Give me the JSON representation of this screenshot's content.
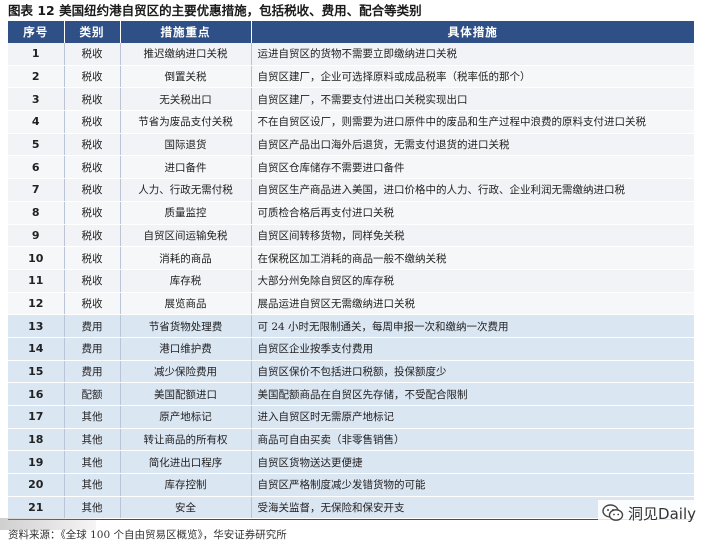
{
  "title": "图表 12  美国纽约港自贸区的主要优惠措施，包括税收、费用、配合等类别",
  "headers": [
    "序号",
    "类别",
    "措施重点",
    "具体措施"
  ],
  "rows": [
    {
      "no": "1",
      "category": "税收",
      "measure": "推迟缴纳进口关税",
      "detail": "运进自贸区的货物不需要立即缴纳进口关税"
    },
    {
      "no": "2",
      "category": "税收",
      "measure": "倒置关税",
      "detail": "自贸区建厂，企业可选择原料或成品税率（税率低的那个）"
    },
    {
      "no": "3",
      "category": "税收",
      "measure": "无关税出口",
      "detail": "自贸区建厂，不需要支付进出口关税实现出口"
    },
    {
      "no": "4",
      "category": "税收",
      "measure": "节省为废品支付关税",
      "detail": "不在自贸区设厂，则需要为进口原件中的废品和生产过程中浪费的原料支付进口关税"
    },
    {
      "no": "5",
      "category": "税收",
      "measure": "国际退货",
      "detail": "自贸区产品出口海外后退货，无需支付退货的进口关税"
    },
    {
      "no": "6",
      "category": "税收",
      "measure": "进口备件",
      "detail": "自贸区仓库储存不需要进口备件"
    },
    {
      "no": "7",
      "category": "税收",
      "measure": "人力、行政无需付税",
      "detail": "自贸区生产商品进入美国，进口价格中的人力、行政、企业利润无需缴纳进口税"
    },
    {
      "no": "8",
      "category": "税收",
      "measure": "质量监控",
      "detail": "可质检合格后再支付进口关税"
    },
    {
      "no": "9",
      "category": "税收",
      "measure": "自贸区间运输免税",
      "detail": "自贸区间转移货物，同样免关税"
    },
    {
      "no": "10",
      "category": "税收",
      "measure": "消耗的商品",
      "detail": "在保税区加工消耗的商品一般不缴纳关税"
    },
    {
      "no": "11",
      "category": "税收",
      "measure": "库存税",
      "detail": "大部分州免除自贸区的库存税"
    },
    {
      "no": "12",
      "category": "税收",
      "measure": "展览商品",
      "detail": "展品运进自贸区无需缴纳进口关税"
    },
    {
      "no": "13",
      "category": "费用",
      "measure": "节省货物处理费",
      "detail": "可 24 小时无限制通关，每周申报一次和缴纳一次费用"
    },
    {
      "no": "14",
      "category": "费用",
      "measure": "港口维护费",
      "detail": "自贸区企业按季支付费用"
    },
    {
      "no": "15",
      "category": "费用",
      "measure": "减少保险费用",
      "detail": "自贸区保价不包括进口税额，投保额度少"
    },
    {
      "no": "16",
      "category": "配额",
      "measure": "美国配额进口",
      "detail": "美国配额商品在自贸区先存储，不受配合限制"
    },
    {
      "no": "17",
      "category": "其他",
      "measure": "原产地标记",
      "detail": "进入自贸区时无需原产地标记"
    },
    {
      "no": "18",
      "category": "其他",
      "measure": "转让商品的所有权",
      "detail": "商品可自由买卖（非零售销售）"
    },
    {
      "no": "19",
      "category": "其他",
      "measure": "简化进出口程序",
      "detail": "自贸区货物送达更便捷"
    },
    {
      "no": "20",
      "category": "其他",
      "measure": "库存控制",
      "detail": "自贸区严格制度减少发错货物的可能"
    },
    {
      "no": "21",
      "category": "其他",
      "measure": "安全",
      "detail": "受海关监督，无保险和保安开支"
    }
  ],
  "source": "资料来源：《全球 100 个自由贸易区概览》，华安证券研究所",
  "watermark": "洞见Daily",
  "colors": {
    "header_bg": "#2f4f87",
    "tax_row_bg": "#f1f3f6",
    "other_row_bg": "#dbe6f3"
  }
}
